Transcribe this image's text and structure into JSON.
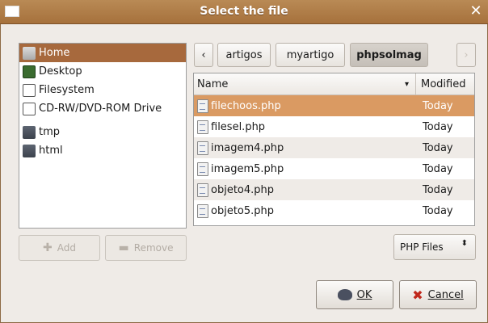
{
  "window": {
    "title": "Select the file",
    "close_glyph": "✕"
  },
  "places": [
    {
      "label": "Home",
      "icon": "home-folder-icon",
      "selected": true
    },
    {
      "label": "Desktop",
      "icon": "desktop-icon"
    },
    {
      "label": "Filesystem",
      "icon": "drive-icon"
    },
    {
      "label": "CD-RW/DVD-ROM Drive",
      "icon": "cdrom-icon"
    },
    {
      "label": "tmp",
      "icon": "folder-icon"
    },
    {
      "label": "html",
      "icon": "folder-icon"
    }
  ],
  "place_buttons": {
    "add": "Add",
    "remove": "Remove"
  },
  "pathbar": {
    "back": "‹",
    "crumbs": [
      "artigos",
      "myartigo",
      "phpsolmag"
    ],
    "forward": "›"
  },
  "filelist": {
    "columns": {
      "name": "Name",
      "modified": "Modified"
    },
    "sort_glyph": "▾",
    "rows": [
      {
        "name": "filechoos.php",
        "modified": "Today",
        "selected": true
      },
      {
        "name": "filesel.php",
        "modified": "Today"
      },
      {
        "name": "imagem4.php",
        "modified": "Today"
      },
      {
        "name": "imagem5.php",
        "modified": "Today"
      },
      {
        "name": "objeto4.php",
        "modified": "Today"
      },
      {
        "name": "objeto5.php",
        "modified": "Today"
      }
    ]
  },
  "filter": {
    "value": "PHP Files",
    "glyph": "⬍"
  },
  "buttons": {
    "ok": "OK",
    "cancel": "Cancel"
  }
}
